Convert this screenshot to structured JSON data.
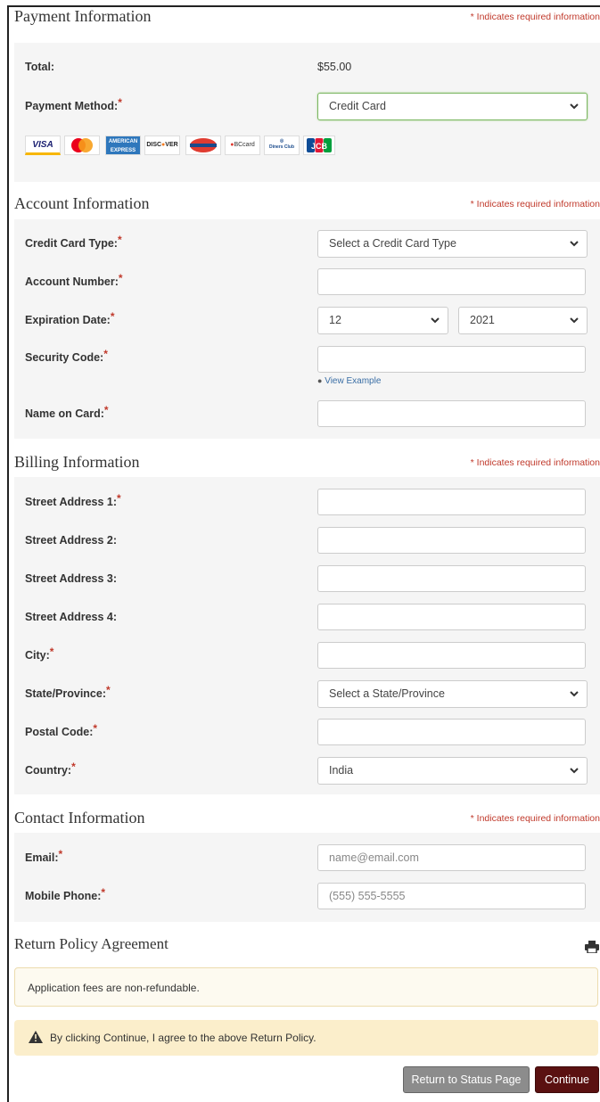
{
  "payment": {
    "title": "Payment Information",
    "required_note": "* Indicates required information",
    "total_label": "Total:",
    "total_value": "$55.00",
    "method_label": "Payment Method:",
    "method_value": "Credit Card",
    "cards": [
      "VISA",
      "MasterCard",
      "AMEX",
      "DISCOVER",
      "Diners",
      "BCcard",
      "Diners Club",
      "JCB"
    ]
  },
  "account": {
    "title": "Account Information",
    "required_note": "* Indicates required information",
    "card_type_label": "Credit Card Type:",
    "card_type_value": "Select a Credit Card Type",
    "account_number_label": "Account Number:",
    "expiration_label": "Expiration Date:",
    "exp_month": "12",
    "exp_year": "2021",
    "security_label": "Security Code:",
    "view_example": "View Example",
    "name_label": "Name on Card:"
  },
  "billing": {
    "title": "Billing Information",
    "required_note": "* Indicates required information",
    "street1_label": "Street Address 1:",
    "street2_label": "Street Address 2:",
    "street3_label": "Street Address 3:",
    "street4_label": "Street Address 4:",
    "city_label": "City:",
    "state_label": "State/Province:",
    "state_value": "Select a State/Province",
    "postal_label": "Postal Code:",
    "country_label": "Country:",
    "country_value": "India"
  },
  "contact": {
    "title": "Contact Information",
    "required_note": "* Indicates required information",
    "email_label": "Email:",
    "email_placeholder": "name@email.com",
    "phone_label": "Mobile Phone:",
    "phone_placeholder": "(555) 555-5555"
  },
  "policy": {
    "title": "Return Policy Agreement",
    "text": "Application fees are non-refundable.",
    "warning": "By clicking Continue, I agree to the above Return Policy."
  },
  "buttons": {
    "return_label": "Return to Status Page",
    "continue_label": "Continue"
  },
  "colors": {
    "required": "#c0392b",
    "continue_bg": "#5a1111",
    "return_bg": "#8c8c8c"
  }
}
